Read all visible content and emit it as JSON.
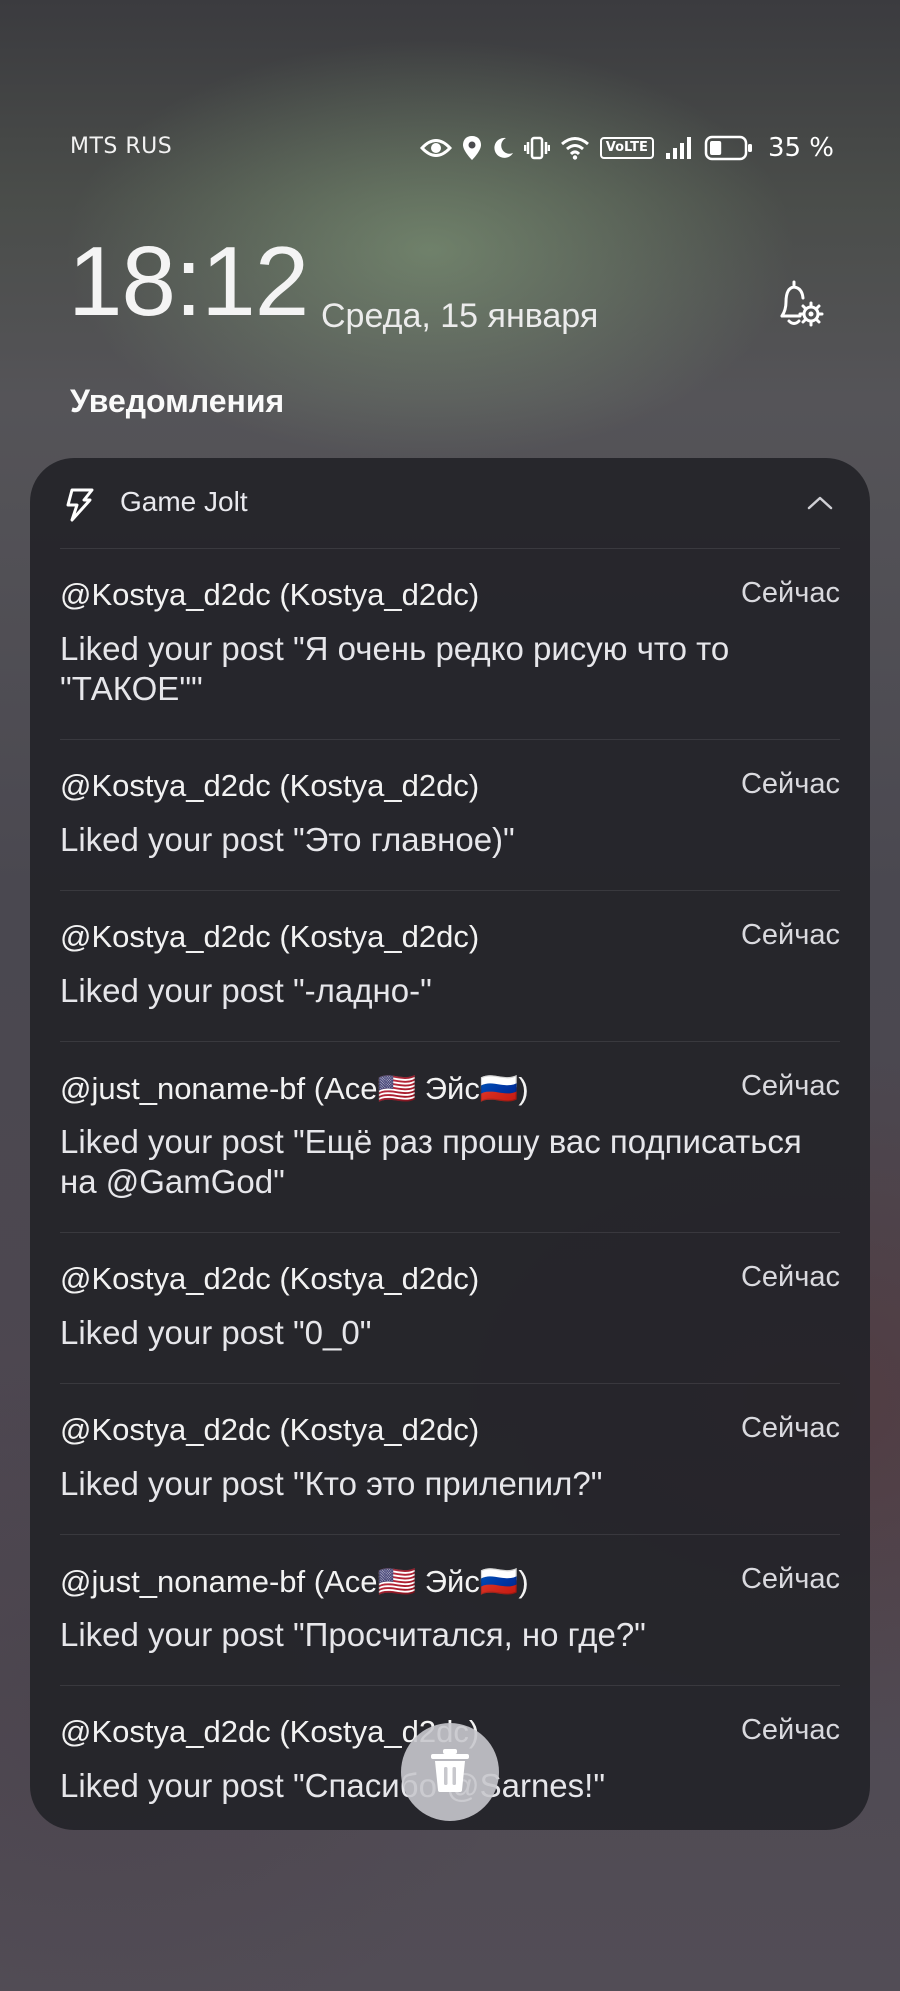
{
  "status": {
    "carrier": "MTS RUS",
    "volte": "VoLTE",
    "battery_percent": "35 %",
    "battery_level": 0.35,
    "icons": [
      "eye-icon",
      "location-icon",
      "moon-icon",
      "vibrate-icon",
      "wifi-icon",
      "volte-icon",
      "signal-icon",
      "battery-icon"
    ]
  },
  "lock": {
    "time": "18:12",
    "date": "Среда, 15 января",
    "bell_icon": "bell-settings-icon"
  },
  "section_title": "Уведомления",
  "group": {
    "app_name": "Game Jolt",
    "app_icon": "game-jolt-icon",
    "collapse_icon": "chevron-up-icon",
    "notifications": [
      {
        "title": "@Kostya_d2dc (Kostya_d2dc)",
        "time": "Сейчас",
        "text": "Liked your post \"Я очень редко рисую что то \"ТАКОЕ\"\""
      },
      {
        "title": "@Kostya_d2dc (Kostya_d2dc)",
        "time": "Сейчас",
        "text": "Liked your post \"Это главное)\""
      },
      {
        "title": "@Kostya_d2dc (Kostya_d2dc)",
        "time": "Сейчас",
        "text": "Liked your post \"-ладно-\""
      },
      {
        "title": "@just_noname-bf (Ace🇺🇸 Эйс🇷🇺)",
        "time": "Сейчас",
        "text": "Liked your post \"Ещё раз прошу вас подписаться на @GamGod\""
      },
      {
        "title": "@Kostya_d2dc (Kostya_d2dc)",
        "time": "Сейчас",
        "text": "Liked your post \"0_0\""
      },
      {
        "title": "@Kostya_d2dc (Kostya_d2dc)",
        "time": "Сейчас",
        "text": "Liked your post \"Кто это прилепил?\""
      },
      {
        "title": "@just_noname-bf (Ace🇺🇸 Эйс🇷🇺)",
        "time": "Сейчас",
        "text": "Liked your post \"Просчитался, но где?\""
      },
      {
        "title": "@Kostya_d2dc (Kostya_d2dc)",
        "time": "Сейчас",
        "text": "Liked your post \"Спасибо @Sarnes!\""
      }
    ]
  },
  "trash_icon": "trash-icon",
  "colors": {
    "card_bg": "#242329",
    "trash_bg": "#c8c8cd"
  }
}
